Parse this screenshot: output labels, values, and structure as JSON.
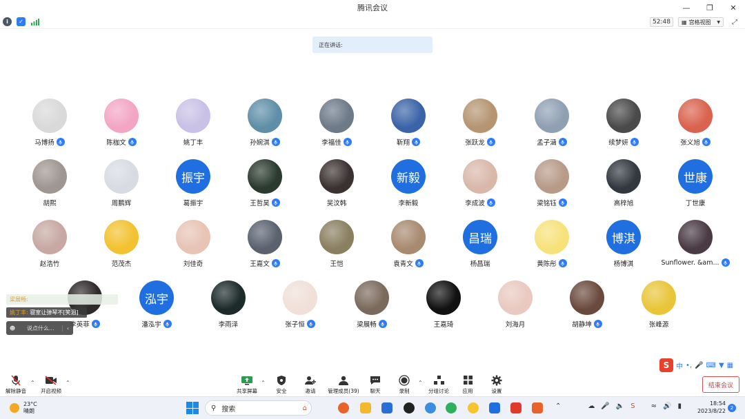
{
  "window": {
    "title": "腾讯会议"
  },
  "toolbar": {
    "timer": "52:48",
    "view_label": "宫格视图"
  },
  "speaking": {
    "label": "正在讲话:"
  },
  "participants": [
    {
      "name": "马博扬",
      "mic": true,
      "color": "#d9d9d9"
    },
    {
      "name": "陈枷文",
      "mic": true,
      "color": "#f2a6c4"
    },
    {
      "name": "姚丁丰",
      "mic": false,
      "color": "#c9c1e6"
    },
    {
      "name": "孙婉淇",
      "mic": true,
      "color": "#5f8fa8"
    },
    {
      "name": "李福佳",
      "mic": true,
      "color": "#6d7a88"
    },
    {
      "name": "靳翔",
      "mic": true,
      "color": "#3b64a8"
    },
    {
      "name": "张跃龙",
      "mic": true,
      "color": "#b59572"
    },
    {
      "name": "孟子涵",
      "mic": true,
      "color": "#8fa0b3"
    },
    {
      "name": "续梦妍",
      "mic": true,
      "color": "#4a4a4a"
    },
    {
      "name": "张义旭",
      "mic": true,
      "color": "#d9634e"
    },
    {
      "name": "胡熙",
      "mic": false,
      "color": "#9e9690"
    },
    {
      "name": "周鹏辉",
      "mic": false,
      "color": "#d8dbe3"
    },
    {
      "name": "葛振宇",
      "mic": false,
      "text": "振宇"
    },
    {
      "name": "王哲昊",
      "mic": true,
      "color": "#2a3a2e"
    },
    {
      "name": "吴汶韩",
      "mic": false,
      "color": "#3a3230"
    },
    {
      "name": "李新毅",
      "mic": false,
      "text": "新毅"
    },
    {
      "name": "李成波",
      "mic": true,
      "color": "#d9b8aa"
    },
    {
      "name": "梁铭钰",
      "mic": true,
      "color": "#b89a88"
    },
    {
      "name": "高梓旭",
      "mic": false,
      "color": "#333840"
    },
    {
      "name": "丁世康",
      "mic": false,
      "text": "世康"
    },
    {
      "name": "赵浩竹",
      "mic": false,
      "color": "#c7a8a2"
    },
    {
      "name": "范茂杰",
      "mic": false,
      "color": "#f2c230"
    },
    {
      "name": "刘佳奇",
      "mic": false,
      "color": "#e7c4b4"
    },
    {
      "name": "王嘉文",
      "mic": true,
      "color": "#5a6270"
    },
    {
      "name": "王恺",
      "mic": false,
      "color": "#8a7f60"
    },
    {
      "name": "袁青文",
      "mic": true,
      "color": "#a88a70"
    },
    {
      "name": "杨昌瑞",
      "mic": false,
      "text": "昌瑞"
    },
    {
      "name": "黄陈彤",
      "mic": true,
      "color": "#f7e27a"
    },
    {
      "name": "杨博淇",
      "mic": false,
      "text": "博淇"
    },
    {
      "name": "Sunflower. &am...",
      "mic": true,
      "color": "#4a3a44"
    },
    {
      "name": "李英菲",
      "mic": true,
      "color": "#2e2a2c"
    },
    {
      "name": "潘泓宇",
      "mic": true,
      "text": "泓宇"
    },
    {
      "name": "李雨泽",
      "mic": false,
      "color": "#1d2a2a"
    },
    {
      "name": "张子恒",
      "mic": true,
      "color": "#f0e0d8"
    },
    {
      "name": "梁展畅",
      "mic": true,
      "color": "#7a6a5c"
    },
    {
      "name": "王嘉琦",
      "mic": false,
      "color": "#111111"
    },
    {
      "name": "刘海月",
      "mic": false,
      "color": "#e9c9c0"
    },
    {
      "name": "胡静坤",
      "mic": true,
      "color": "#6b4a3e"
    },
    {
      "name": "张峰源",
      "mic": false,
      "color": "#e9c53a"
    }
  ],
  "chat": {
    "msg1_name": "梁展畅:",
    "msg2_name": "姚丁丰:",
    "msg2_text": "寝室让弹琴不[笑泪]",
    "input_placeholder": "说点什么..."
  },
  "ime": {
    "brand": "S",
    "mode": "中"
  },
  "controls": {
    "mute": "解除静音",
    "video": "开启视频",
    "share": "共享屏幕",
    "security": "安全",
    "invite": "邀请",
    "members": "管理成员(39)",
    "chat": "聊天",
    "record": "录制",
    "breakout": "分组讨论",
    "apps": "应用",
    "settings": "设置",
    "end": "结束会议"
  },
  "taskbar": {
    "temp": "23°C",
    "weather": "晴朗",
    "search": "搜索",
    "time": "18:54",
    "date": "2023/8/22",
    "notif_count": "2"
  }
}
